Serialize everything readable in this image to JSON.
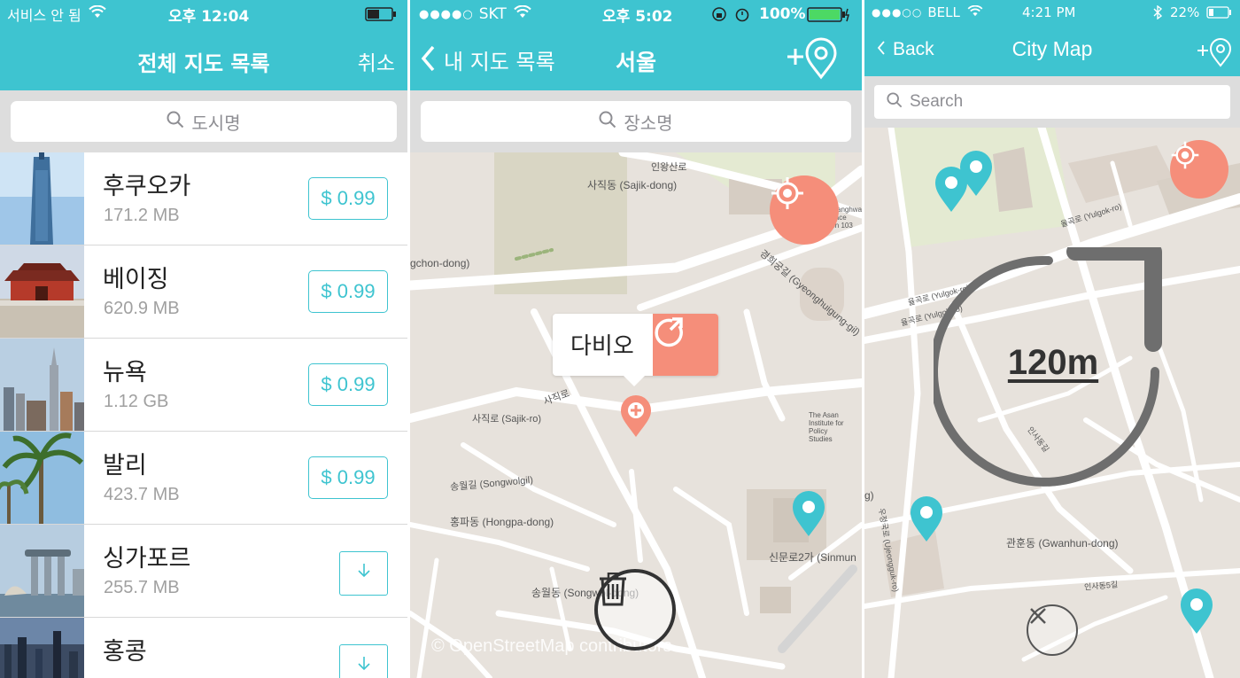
{
  "colors": {
    "accent": "#3ec4d0",
    "coral": "#f58e7a",
    "map_bg": "#e7e2dc"
  },
  "panel1": {
    "status": {
      "carrier": "서비스 안 됨",
      "time": "오후 12:04"
    },
    "title": "전체 지도 목록",
    "cancel_label": "취소",
    "search_placeholder": "도시명",
    "items": [
      {
        "name": "후쿠오카",
        "size": "171.2 MB",
        "price": "$ 0.99",
        "action": "price"
      },
      {
        "name": "베이징",
        "size": "620.9 MB",
        "price": "$ 0.99",
        "action": "price"
      },
      {
        "name": "뉴욕",
        "size": "1.12 GB",
        "price": "$ 0.99",
        "action": "price"
      },
      {
        "name": "발리",
        "size": "423.7 MB",
        "price": "$ 0.99",
        "action": "price"
      },
      {
        "name": "싱가포르",
        "size": "255.7 MB",
        "action": "download-icon"
      },
      {
        "name": "홍콩",
        "size": "",
        "action": "download-icon"
      }
    ]
  },
  "panel2": {
    "status": {
      "carrier": "SKT",
      "time": "오후 5:02",
      "battery": "100%"
    },
    "back_label": "내 지도 목록",
    "title": "서울",
    "search_placeholder": "장소명",
    "popup_label": "다비오",
    "attribution": "© OpenStreetMap contributors",
    "map_labels": {
      "sajik_dong": "사직동 (Sajik-dong)",
      "inwang": "인왕산로",
      "gchon": "gchon-dong)",
      "sajik_ro_v": "사직로",
      "gyeonghuigung": "경희궁길 (Gyeonghuigung-gil)",
      "sajik_ro": "사직로 (Sajik-ro)",
      "hongpa": "홍파동 (Hongpa-dong)",
      "songwolgil": "송월길 (Songwolgil)",
      "songwol_dong": "송월동 (Songwol-dong)",
      "sinmun": "신문로2가 (Sinmun",
      "asan": "The Asan Institute for Policy Studies",
      "gwanghwamun": "Gwanghwamun Space Bon 103"
    }
  },
  "panel3": {
    "status": {
      "carrier": "BELL",
      "time": "4:21 PM",
      "battery": "22%"
    },
    "back_label": "Back",
    "title": "City Map",
    "search_placeholder": "Search",
    "distance": "120m",
    "map_labels": {
      "yulgok": "율곡로 (Yulgok-ro)",
      "yulgok2": "율곡로 (Yulgok-ro)",
      "yulgok3": "율곡로 (Yulgok-ro)",
      "insadong": "인사동길",
      "gwanhun": "관훈동 (Gwanhun-dong)",
      "ujeongguk": "우정국로 (Ujeongguk-ro)",
      "gyeonghwi": "g)",
      "insadong5": "인사동5길"
    }
  }
}
